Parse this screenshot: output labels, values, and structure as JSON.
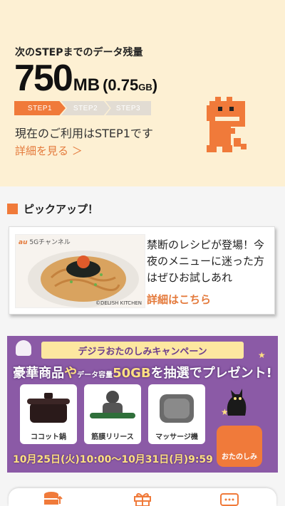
{
  "data_status": {
    "label": "次のSTEPまでのデータ残量",
    "amount_value": "750",
    "amount_unit": "MB",
    "amount_paren_open": "(",
    "amount_gb_value": "0.75",
    "amount_gb_unit": "GB",
    "amount_paren_close": ")",
    "steps": [
      "STEP1",
      "STEP2",
      "STEP3"
    ],
    "current_step_index": 0,
    "current_use_text": "現在のご利用はSTEP1です",
    "details_link": "詳細を見る ＞"
  },
  "pickup": {
    "title": "ピックアップ！",
    "card": {
      "thumb_brand": "au",
      "thumb_channel": "5Gチャンネル",
      "thumb_credit": "©DELISH KITCHEN",
      "text": "禁断のレシピが登場！今夜のメニューに迷った方はぜひお試しあれ",
      "link": "詳細はこちら"
    }
  },
  "campaign": {
    "title": "デジラおたのしみキャンペーン",
    "headline_a": "豪華商品",
    "headline_b": "や",
    "headline_c": "データ容量",
    "headline_d": "50GB",
    "headline_e": "を抽選でプレゼント!",
    "prizes": [
      "ココット鍋",
      "筋膜リリース",
      "マッサージ機"
    ],
    "dates": "10月25日(火)10:00〜10月31日(月)9:59",
    "badge": "おたのしみ"
  },
  "colors": {
    "accent": "#f07a3a",
    "panel_bg": "#fdf0d3",
    "campaign_bg": "#8b5aa6"
  },
  "icons": [
    "database-icon",
    "gift-icon",
    "chat-icon"
  ]
}
